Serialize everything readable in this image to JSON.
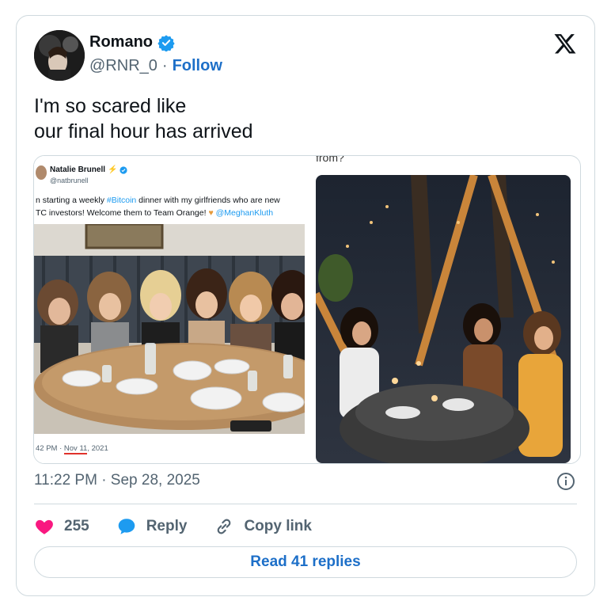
{
  "author": {
    "name": "Romano",
    "handle": "@RNR_0",
    "separator": "·",
    "follow_label": "Follow"
  },
  "tweet": {
    "line1": "I'm so scared like",
    "line2": "our final hour has arrived"
  },
  "quoted": {
    "name": "Natalie Brunell",
    "handle": "@natbrunell",
    "text_part1": "n starting a weekly ",
    "hashtag": "#Bitcoin",
    "text_part2": " dinner with my girlfriends who are new",
    "text_line2a": "TC investors! Welcome them to Team Orange! ",
    "mention": "@MeghanKluth",
    "time_prefix": "42 PM · ",
    "time_date": "Nov 11",
    "time_year": ", 2021"
  },
  "right_caption": "from?",
  "timestamp": "11:22 PM · Sep 28, 2025",
  "actions": {
    "like_count": "255",
    "reply_label": "Reply",
    "copy_label": "Copy link"
  },
  "read_replies_label": "Read 41 replies",
  "colors": {
    "accent": "#1d6fc8",
    "like": "#f91880",
    "reply": "#1d9bf0",
    "verified": "#1d9bf0"
  }
}
